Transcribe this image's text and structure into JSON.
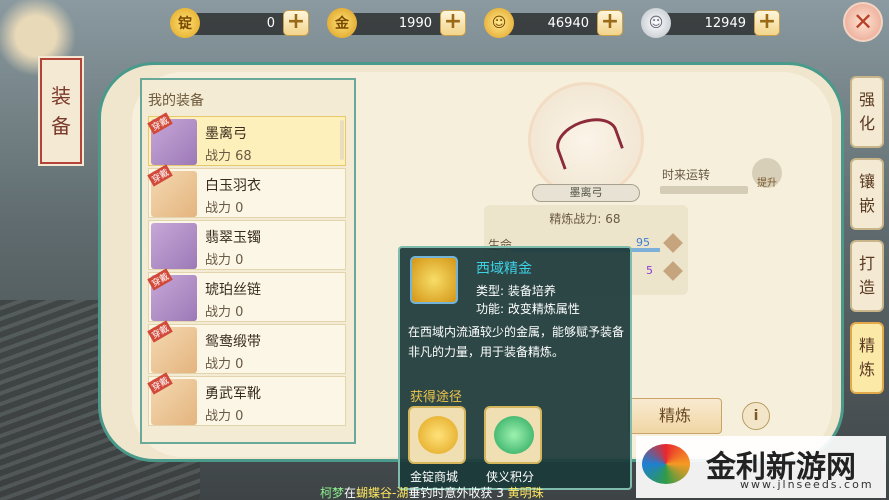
{
  "currencies": [
    {
      "icon": "gold-ingot-icon",
      "value": "0"
    },
    {
      "icon": "gold-coin-stack-icon",
      "value": "1990"
    },
    {
      "icon": "gold-coin-icon",
      "value": "46940"
    },
    {
      "icon": "silver-coin-icon",
      "value": "12949"
    }
  ],
  "banner": {
    "char1": "装",
    "char2": "备"
  },
  "list": {
    "title": "我的装备",
    "tag": "穿戴",
    "items": [
      {
        "name": "墨离弓",
        "power": "战力 68"
      },
      {
        "name": "白玉羽衣",
        "power": "战力 0"
      },
      {
        "name": "翡翠玉镯",
        "power": "战力 0"
      },
      {
        "name": "琥珀丝链",
        "power": "战力 0"
      },
      {
        "name": "鸳鸯缎带",
        "power": "战力 0"
      },
      {
        "name": "勇武军靴",
        "power": "战力 0"
      }
    ]
  },
  "detail": {
    "item_name": "墨离弓",
    "refine_power": "精炼战力: 68",
    "luck_label": "时来运转",
    "luck_button": "提升",
    "stat_name": "生命",
    "stat_value_1": "95",
    "stat_value_2": "5",
    "refine_button": "精炼",
    "info_button": "i"
  },
  "tabs": [
    {
      "c1": "强",
      "c2": "化"
    },
    {
      "c1": "镶",
      "c2": "嵌"
    },
    {
      "c1": "打",
      "c2": "造"
    },
    {
      "c1": "精",
      "c2": "炼"
    }
  ],
  "tooltip": {
    "title": "西域精金",
    "type_line": "类型: 装备培养",
    "func_line": "功能: 改变精炼属性",
    "description": "在西域内流通较少的金属，能够赋予装备非凡的力量，用于装备精炼。",
    "sources_title": "获得途径",
    "sources": [
      {
        "label": "金锭商城"
      },
      {
        "label": "侠义积分"
      }
    ]
  },
  "ticker": {
    "name": "柯梦",
    "prefix": "在",
    "place": "蝴蝶谷-湖",
    "text": "垂钓时意外收获 3 ",
    "item": "黄明珠"
  },
  "watermark": {
    "text": "金利新游网",
    "url": "www.jlnseeds.com"
  },
  "colors": {
    "panel_border": "#4a9a8c",
    "accent_gold": "#f0c44a",
    "tooltip_title": "#3fd1e6"
  }
}
